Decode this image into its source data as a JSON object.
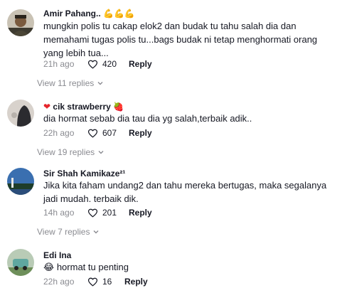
{
  "comments": [
    {
      "username": "Amir Pahang..",
      "username_suffix": "💪💪💪",
      "text": "mungkin polis tu cakap elok2 dan budak tu tahu salah dia dan memahami tugas polis tu...bags budak ni tetap menghormati orang yang lebih tua...",
      "time": "21h ago",
      "likes": "420",
      "reply_label": "Reply",
      "view_replies": "View 11 replies"
    },
    {
      "username_prefix": "❤",
      "username": "cik strawberry",
      "username_suffix": "🍓",
      "text": "dia hormat sebab dia tau dia yg salah,terbaik adik..",
      "time": "22h ago",
      "likes": "607",
      "reply_label": "Reply",
      "view_replies": "View 19 replies"
    },
    {
      "username": "Sir Shah Kamikaze²¹",
      "text": "Jika kita faham undang2 dan tahu mereka bertugas, maka segalanya jadi mudah. terbaik dik.",
      "time": "14h ago",
      "likes": "201",
      "reply_label": "Reply",
      "view_replies": "View 7 replies"
    },
    {
      "username": "Edi Ina",
      "text_emoji": "😂",
      "text": "hormat tu penting",
      "time": "22h ago",
      "likes": "16",
      "reply_label": "Reply"
    }
  ],
  "colors": {
    "text": "#161823",
    "muted": "#8a8b91",
    "background": "#ffffff",
    "heart_red": "#e5242b"
  },
  "icons": {
    "like": "heart-outline-icon",
    "expand": "chevron-down-icon"
  }
}
